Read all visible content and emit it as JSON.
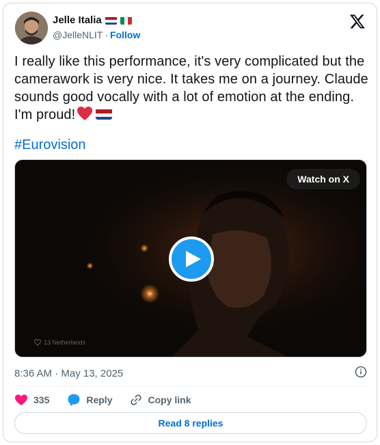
{
  "author": {
    "display_name": "Jelle Italia",
    "handle": "@JelleNLIT",
    "separator": "·",
    "follow_label": "Follow"
  },
  "tweet": {
    "lines": [
      "I really like this performance, it's very complicated but the",
      "camerawork is very nice. It takes me on a journey. Claude",
      "sounds good vocally with a lot of emotion at the ending.",
      "I'm proud!"
    ],
    "hashtag": "#Eurovision"
  },
  "media": {
    "watch_label": "Watch on X",
    "watermark": "13 Netherlands"
  },
  "timestamp": "8:36 AM · May 13, 2025",
  "actions": {
    "likes_count": "335",
    "reply_label": "Reply",
    "copy_link_label": "Copy link"
  },
  "read_replies_label": "Read 8 replies",
  "colors": {
    "link_blue": "#006fd6",
    "like_pink": "#f91880",
    "reply_blue": "#1d9bf0",
    "secondary_text": "#536471",
    "border": "#cfd9de"
  },
  "icons": {
    "x_logo": "x-logo-icon",
    "play": "play-icon",
    "info": "info-icon",
    "heart": "heart-icon",
    "reply": "reply-bubble-icon",
    "link": "link-icon"
  }
}
